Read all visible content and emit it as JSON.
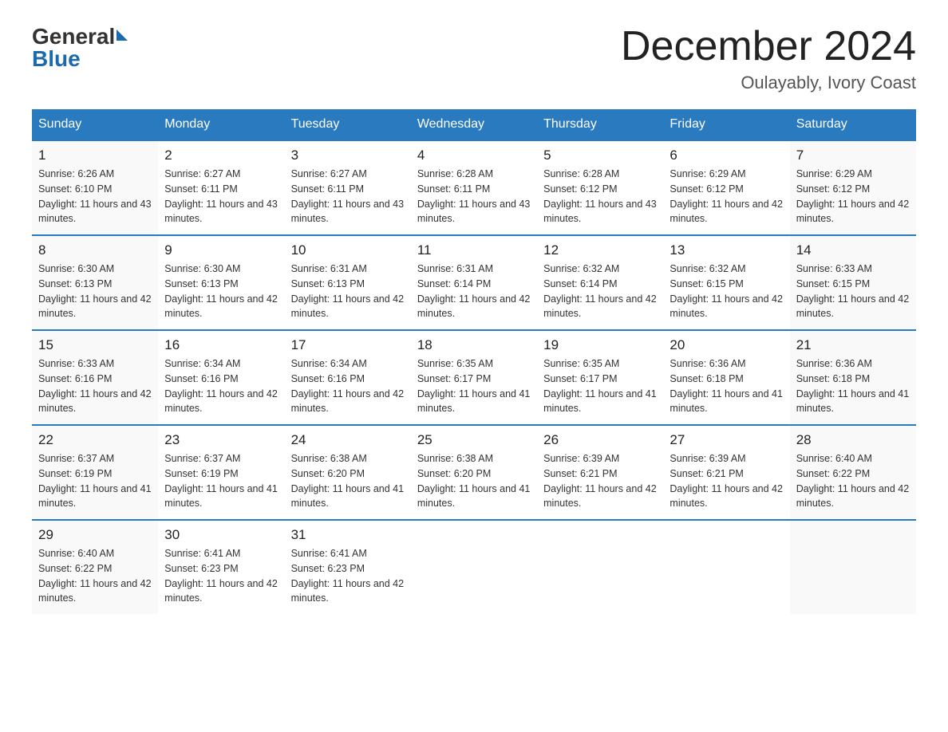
{
  "header": {
    "logo_general": "General",
    "logo_blue": "Blue",
    "month_title": "December 2024",
    "location": "Oulayably, Ivory Coast"
  },
  "weekdays": [
    "Sunday",
    "Monday",
    "Tuesday",
    "Wednesday",
    "Thursday",
    "Friday",
    "Saturday"
  ],
  "weeks": [
    [
      {
        "day": "1",
        "sunrise": "Sunrise: 6:26 AM",
        "sunset": "Sunset: 6:10 PM",
        "daylight": "Daylight: 11 hours and 43 minutes."
      },
      {
        "day": "2",
        "sunrise": "Sunrise: 6:27 AM",
        "sunset": "Sunset: 6:11 PM",
        "daylight": "Daylight: 11 hours and 43 minutes."
      },
      {
        "day": "3",
        "sunrise": "Sunrise: 6:27 AM",
        "sunset": "Sunset: 6:11 PM",
        "daylight": "Daylight: 11 hours and 43 minutes."
      },
      {
        "day": "4",
        "sunrise": "Sunrise: 6:28 AM",
        "sunset": "Sunset: 6:11 PM",
        "daylight": "Daylight: 11 hours and 43 minutes."
      },
      {
        "day": "5",
        "sunrise": "Sunrise: 6:28 AM",
        "sunset": "Sunset: 6:12 PM",
        "daylight": "Daylight: 11 hours and 43 minutes."
      },
      {
        "day": "6",
        "sunrise": "Sunrise: 6:29 AM",
        "sunset": "Sunset: 6:12 PM",
        "daylight": "Daylight: 11 hours and 42 minutes."
      },
      {
        "day": "7",
        "sunrise": "Sunrise: 6:29 AM",
        "sunset": "Sunset: 6:12 PM",
        "daylight": "Daylight: 11 hours and 42 minutes."
      }
    ],
    [
      {
        "day": "8",
        "sunrise": "Sunrise: 6:30 AM",
        "sunset": "Sunset: 6:13 PM",
        "daylight": "Daylight: 11 hours and 42 minutes."
      },
      {
        "day": "9",
        "sunrise": "Sunrise: 6:30 AM",
        "sunset": "Sunset: 6:13 PM",
        "daylight": "Daylight: 11 hours and 42 minutes."
      },
      {
        "day": "10",
        "sunrise": "Sunrise: 6:31 AM",
        "sunset": "Sunset: 6:13 PM",
        "daylight": "Daylight: 11 hours and 42 minutes."
      },
      {
        "day": "11",
        "sunrise": "Sunrise: 6:31 AM",
        "sunset": "Sunset: 6:14 PM",
        "daylight": "Daylight: 11 hours and 42 minutes."
      },
      {
        "day": "12",
        "sunrise": "Sunrise: 6:32 AM",
        "sunset": "Sunset: 6:14 PM",
        "daylight": "Daylight: 11 hours and 42 minutes."
      },
      {
        "day": "13",
        "sunrise": "Sunrise: 6:32 AM",
        "sunset": "Sunset: 6:15 PM",
        "daylight": "Daylight: 11 hours and 42 minutes."
      },
      {
        "day": "14",
        "sunrise": "Sunrise: 6:33 AM",
        "sunset": "Sunset: 6:15 PM",
        "daylight": "Daylight: 11 hours and 42 minutes."
      }
    ],
    [
      {
        "day": "15",
        "sunrise": "Sunrise: 6:33 AM",
        "sunset": "Sunset: 6:16 PM",
        "daylight": "Daylight: 11 hours and 42 minutes."
      },
      {
        "day": "16",
        "sunrise": "Sunrise: 6:34 AM",
        "sunset": "Sunset: 6:16 PM",
        "daylight": "Daylight: 11 hours and 42 minutes."
      },
      {
        "day": "17",
        "sunrise": "Sunrise: 6:34 AM",
        "sunset": "Sunset: 6:16 PM",
        "daylight": "Daylight: 11 hours and 42 minutes."
      },
      {
        "day": "18",
        "sunrise": "Sunrise: 6:35 AM",
        "sunset": "Sunset: 6:17 PM",
        "daylight": "Daylight: 11 hours and 41 minutes."
      },
      {
        "day": "19",
        "sunrise": "Sunrise: 6:35 AM",
        "sunset": "Sunset: 6:17 PM",
        "daylight": "Daylight: 11 hours and 41 minutes."
      },
      {
        "day": "20",
        "sunrise": "Sunrise: 6:36 AM",
        "sunset": "Sunset: 6:18 PM",
        "daylight": "Daylight: 11 hours and 41 minutes."
      },
      {
        "day": "21",
        "sunrise": "Sunrise: 6:36 AM",
        "sunset": "Sunset: 6:18 PM",
        "daylight": "Daylight: 11 hours and 41 minutes."
      }
    ],
    [
      {
        "day": "22",
        "sunrise": "Sunrise: 6:37 AM",
        "sunset": "Sunset: 6:19 PM",
        "daylight": "Daylight: 11 hours and 41 minutes."
      },
      {
        "day": "23",
        "sunrise": "Sunrise: 6:37 AM",
        "sunset": "Sunset: 6:19 PM",
        "daylight": "Daylight: 11 hours and 41 minutes."
      },
      {
        "day": "24",
        "sunrise": "Sunrise: 6:38 AM",
        "sunset": "Sunset: 6:20 PM",
        "daylight": "Daylight: 11 hours and 41 minutes."
      },
      {
        "day": "25",
        "sunrise": "Sunrise: 6:38 AM",
        "sunset": "Sunset: 6:20 PM",
        "daylight": "Daylight: 11 hours and 41 minutes."
      },
      {
        "day": "26",
        "sunrise": "Sunrise: 6:39 AM",
        "sunset": "Sunset: 6:21 PM",
        "daylight": "Daylight: 11 hours and 42 minutes."
      },
      {
        "day": "27",
        "sunrise": "Sunrise: 6:39 AM",
        "sunset": "Sunset: 6:21 PM",
        "daylight": "Daylight: 11 hours and 42 minutes."
      },
      {
        "day": "28",
        "sunrise": "Sunrise: 6:40 AM",
        "sunset": "Sunset: 6:22 PM",
        "daylight": "Daylight: 11 hours and 42 minutes."
      }
    ],
    [
      {
        "day": "29",
        "sunrise": "Sunrise: 6:40 AM",
        "sunset": "Sunset: 6:22 PM",
        "daylight": "Daylight: 11 hours and 42 minutes."
      },
      {
        "day": "30",
        "sunrise": "Sunrise: 6:41 AM",
        "sunset": "Sunset: 6:23 PM",
        "daylight": "Daylight: 11 hours and 42 minutes."
      },
      {
        "day": "31",
        "sunrise": "Sunrise: 6:41 AM",
        "sunset": "Sunset: 6:23 PM",
        "daylight": "Daylight: 11 hours and 42 minutes."
      },
      {
        "day": "",
        "sunrise": "",
        "sunset": "",
        "daylight": ""
      },
      {
        "day": "",
        "sunrise": "",
        "sunset": "",
        "daylight": ""
      },
      {
        "day": "",
        "sunrise": "",
        "sunset": "",
        "daylight": ""
      },
      {
        "day": "",
        "sunrise": "",
        "sunset": "",
        "daylight": ""
      }
    ]
  ]
}
